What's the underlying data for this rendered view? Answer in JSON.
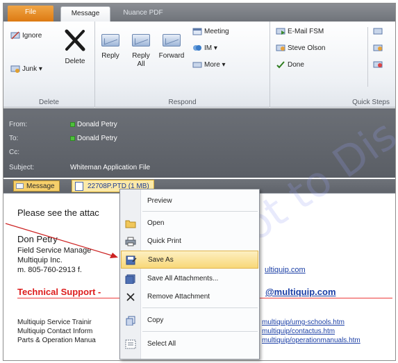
{
  "tabs": [
    "File",
    "Message",
    "Nuance PDF"
  ],
  "ribbon": {
    "delete_group": {
      "label": "Delete",
      "ignore": "Ignore",
      "junk": "Junk ▾",
      "delete": "Delete"
    },
    "respond_group": {
      "label": "Respond",
      "reply": "Reply",
      "reply_all": "Reply All",
      "forward": "Forward",
      "meeting": "Meeting",
      "im": "IM ▾",
      "more": "More ▾"
    },
    "quick_steps_group": {
      "label": "Quick Steps",
      "items": [
        "E-Mail FSM",
        "Steve Olson",
        "Done"
      ]
    }
  },
  "header": {
    "from_label": "From:",
    "from_value": "Donald Petry",
    "to_label": "To:",
    "to_value": "Donald Petry",
    "cc_label": "Cc:",
    "subject_label": "Subject:",
    "subject_value": "Whiteman Application File"
  },
  "attachments": {
    "message_tab": "Message",
    "file": "22708P.PTD (1 MB)"
  },
  "body": {
    "intro": "Please see the attac",
    "name": "Don Petry",
    "title": "Field Service Manage",
    "company": "Multiquip Inc.",
    "phone": "m. 805-760-2913   f.",
    "email_frag": "ultiquip.com",
    "tech": "Technical Support -",
    "tech_email": "@multiquip.com",
    "l1": "Multiquip Service Trainir",
    "l1_link": "multiquip/umg-schools.htm",
    "l2": "Multiquip Contact Inform",
    "l2_link": "multiquip/contactus.htm",
    "l3": "Parts & Operation Manua",
    "l3_link": "multiquip/operationmanuals.htm"
  },
  "context_menu": [
    "Preview",
    "Open",
    "Quick Print",
    "Save As",
    "Save All Attachments...",
    "Remove Attachment",
    "Copy",
    "Select All"
  ],
  "watermark": "Not to Dis",
  "colors": {
    "highlight": "#f8d878",
    "file_tab": "#dd7a12",
    "tech_red": "#dd1d1d",
    "link_blue": "#1a3ea5"
  }
}
